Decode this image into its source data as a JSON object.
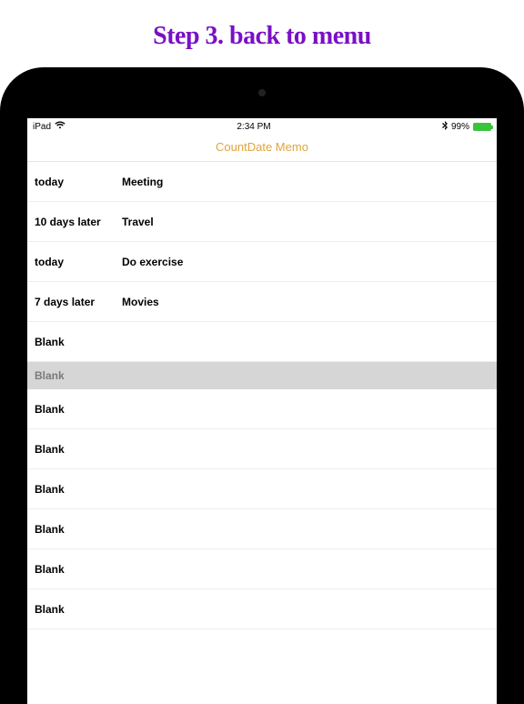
{
  "promo": {
    "title": "Step 3. back to menu"
  },
  "status": {
    "carrier": "iPad",
    "time": "2:34 PM",
    "battery_pct": "99%"
  },
  "app": {
    "title": "CountDate Memo"
  },
  "rows": [
    {
      "when": "today",
      "what": "Meeting"
    },
    {
      "when": "10  days later",
      "what": "Travel"
    },
    {
      "when": "today",
      "what": "Do exercise"
    },
    {
      "when": "7  days later",
      "what": "Movies"
    },
    {
      "when": "Blank",
      "what": ""
    },
    {
      "when": "Blank",
      "what": "",
      "highlight": true
    },
    {
      "when": "Blank",
      "what": ""
    },
    {
      "when": "Blank",
      "what": ""
    },
    {
      "when": "Blank",
      "what": ""
    },
    {
      "when": "Blank",
      "what": ""
    },
    {
      "when": "Blank",
      "what": ""
    },
    {
      "when": "Blank",
      "what": ""
    }
  ]
}
